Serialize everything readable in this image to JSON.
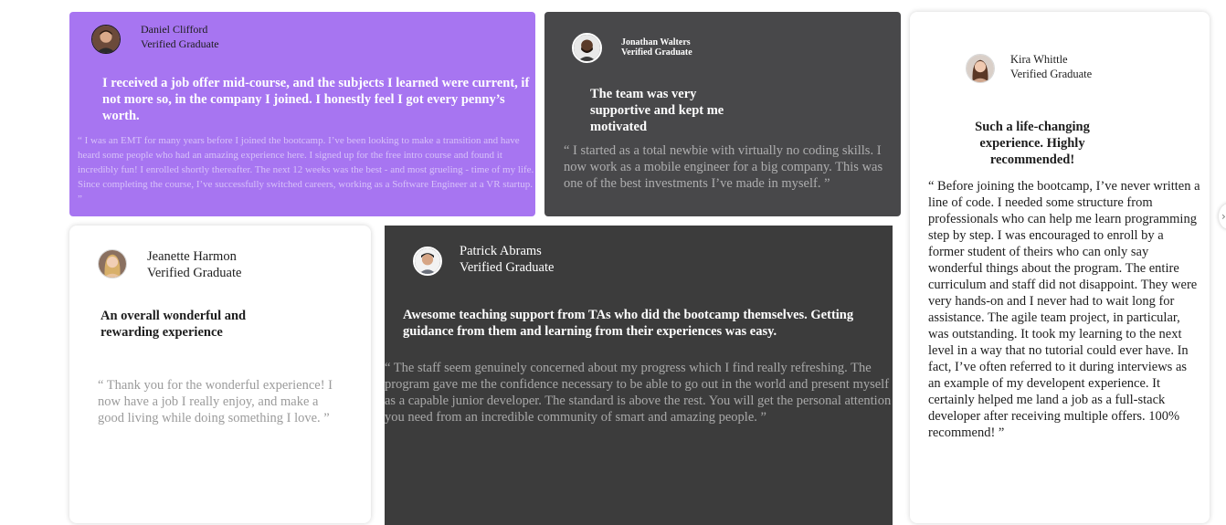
{
  "testimonials": [
    {
      "name": "Daniel Clifford",
      "role": "Verified Graduate",
      "headline": "I received a job offer mid-course, and the subjects I learned were current, if not more so, in the company I joined. I honestly feel I got every penny’s worth.",
      "quote": "“ I was an EMT for many years before I joined the bootcamp. I’ve been looking to make a transition and have heard some people who had an amazing experience here. I signed up for the free intro course and found it incredibly fun! I enrolled shortly thereafter. The next 12 weeks was the best - and most grueling - time of my life. Since completing the course, I’ve successfully switched careers, working as a Software Engineer at a VR startup. ”",
      "card_color": "#a775f1"
    },
    {
      "name": "Jonathan Walters",
      "role": "Verified Graduate",
      "headline": "The team was very supportive and kept me motivated",
      "quote": "“ I started as a total newbie with virtually no coding skills. I now work as a mobile engineer for a big company. This was one of the best investments I’ve made in myself. ”",
      "card_color": "#48484a"
    },
    {
      "name": "Kira Whittle",
      "role": "Verified Graduate",
      "headline": "Such a life-changing experience. Highly recommended!",
      "quote": "“ Before joining the bootcamp, I’ve never written a line of code. I needed some structure from professionals who can help me learn programming step by step. I was encouraged to enroll by a former student of theirs who can only say wonderful things about the program. The entire curriculum and staff did not disappoint. They were very hands-on and I never had to wait long for assistance. The agile team project, in particular, was outstanding. It took my learning to the next level in a way that no tutorial could ever have. In fact, I’ve often referred to it during interviews as an example of my developent experience. It certainly helped me land a job as a full-stack developer after receiving multiple offers. 100% recommend! ”",
      "card_color": "#ffffff"
    },
    {
      "name": "Jeanette Harmon",
      "role": "Verified Graduate",
      "headline": "An overall wonderful and rewarding experience",
      "quote": "“ Thank you for the wonderful experience! I now have a job I really enjoy, and make a good living while doing something I love. ”",
      "card_color": "#ffffff"
    },
    {
      "name": "Patrick Abrams",
      "role": "Verified Graduate",
      "headline": "Awesome teaching support from TAs who did the bootcamp themselves. Getting guidance from them and learning from their experiences was easy.",
      "quote": "“ The staff seem genuinely concerned about my progress which I find really refreshing. The program gave me the confidence necessary to be able to go out in the world and present myself as a capable junior developer. The standard is above the rest. You will get the personal attention you need from an incredible community of smart and amazing people. ”",
      "card_color": "#3c3c3c"
    }
  ],
  "carousel": {
    "next_icon": "chevron-right-icon"
  }
}
